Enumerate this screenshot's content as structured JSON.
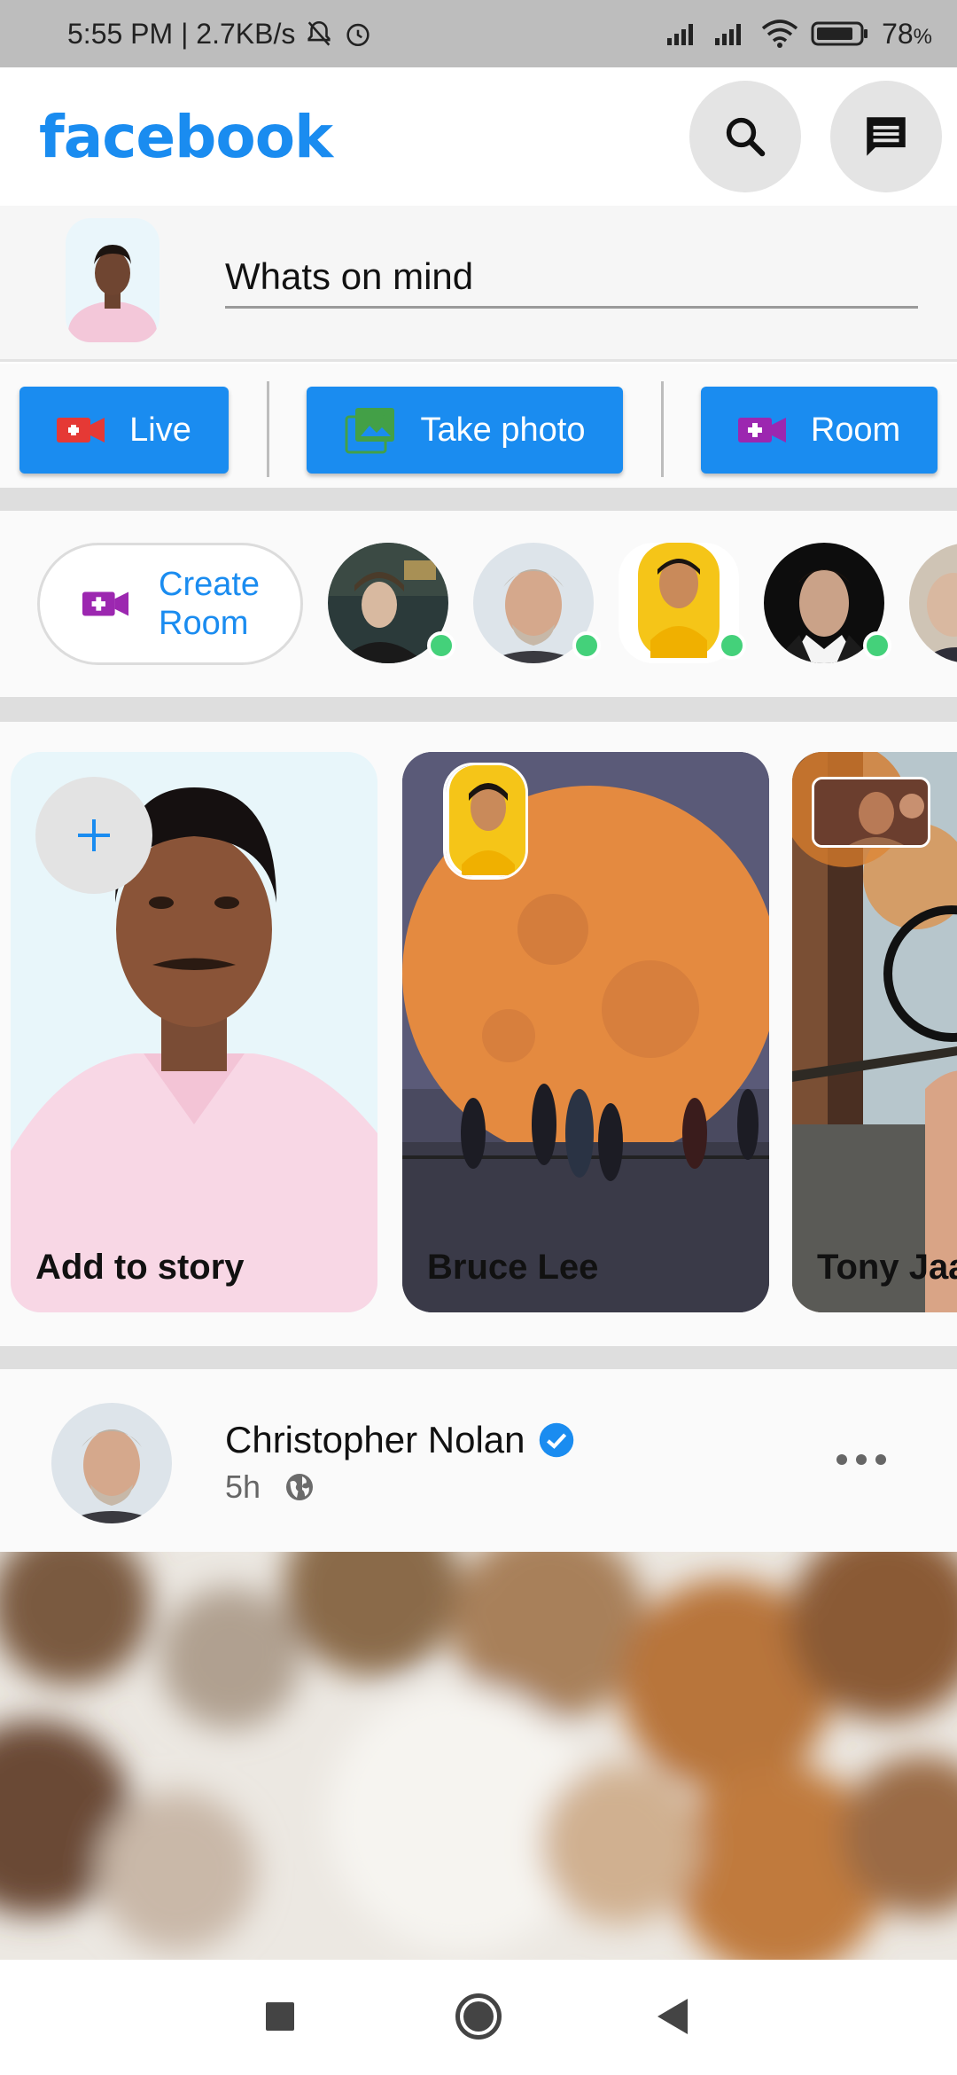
{
  "status_bar": {
    "time_speed": "5:55 PM | 2.7KB/s",
    "battery": "78",
    "battery_unit": "%"
  },
  "header": {
    "logo": "facebook",
    "search_icon": "search-icon",
    "messenger_icon": "messenger-icon"
  },
  "composer": {
    "placeholder": "Whats on mind"
  },
  "actions": {
    "live_label": "Live",
    "photo_label": "Take photo",
    "room_label": "Room"
  },
  "rooms": {
    "create_label_line1": "Create",
    "create_label_line2": "Room",
    "online_color": "#44d17a"
  },
  "stories": [
    {
      "name": "Add to story"
    },
    {
      "name": "Bruce Lee"
    },
    {
      "name": "Tony Jaa"
    }
  ],
  "post": {
    "author": "Christopher Nolan",
    "time": "5h",
    "verified": true
  },
  "colors": {
    "brand": "#1a8cf0",
    "live_icon": "#e53935",
    "photo_icon": "#43a047",
    "room_icon": "#9c27b0"
  }
}
